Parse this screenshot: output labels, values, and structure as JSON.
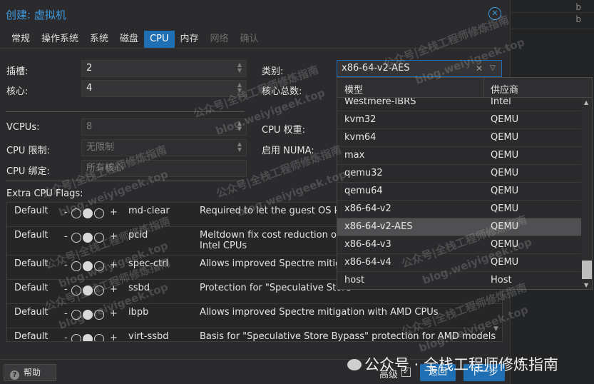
{
  "background": {
    "cells": [
      "b",
      "b"
    ]
  },
  "dialog": {
    "title": "创建: 虚拟机",
    "close_icon": "close-icon",
    "tabs": [
      {
        "label": "常规",
        "state": "normal"
      },
      {
        "label": "操作系统",
        "state": "normal"
      },
      {
        "label": "系统",
        "state": "normal"
      },
      {
        "label": "磁盘",
        "state": "normal"
      },
      {
        "label": "CPU",
        "state": "active"
      },
      {
        "label": "内存",
        "state": "normal"
      },
      {
        "label": "网络",
        "state": "disabled"
      },
      {
        "label": "确认",
        "state": "disabled"
      }
    ]
  },
  "form": {
    "sockets_label": "插槽:",
    "sockets_value": "2",
    "cores_label": "核心:",
    "cores_value": "4",
    "type_label": "类别:",
    "type_value": "x86-64-v2-AES",
    "total_cores_label": "核心总数:",
    "vcpus_label": "VCPUs:",
    "vcpus_value": "8",
    "cpu_weight_label": "CPU 权重:",
    "cpu_limit_label": "CPU 限制:",
    "cpu_limit_value": "无限制",
    "numa_label": "启用 NUMA:",
    "cpu_affinity_label": "CPU 绑定:",
    "cpu_affinity_value": "所有核心",
    "extra_flags_label": "Extra CPU Flags:"
  },
  "flags": [
    {
      "state": "Default",
      "minus": "-",
      "plus": "+",
      "name": "md-clear",
      "desc": "Required to let the guest OS kno"
    },
    {
      "state": "Default",
      "minus": "-",
      "plus": "+",
      "name": "pcid",
      "desc": "Meltdown fix cost reduction on W",
      "desc2": "Intel CPUs"
    },
    {
      "state": "Default",
      "minus": "-",
      "plus": "+",
      "name": "spec-ctrl",
      "desc": "Allows improved Spectre mitigatio"
    },
    {
      "state": "Default",
      "minus": "-",
      "plus": "+",
      "name": "ssbd",
      "desc": "Protection for \"Speculative Store"
    },
    {
      "state": "Default",
      "minus": "-",
      "plus": "+",
      "name": "ibpb",
      "desc": "Allows improved Spectre mitigation with AMD CPUs"
    },
    {
      "state": "Default",
      "minus": "-",
      "plus": "+",
      "name": "virt-ssbd",
      "desc": "Basis for \"Speculative Store Bypass\" protection for AMD models"
    }
  ],
  "dropdown": {
    "col_model": "模型",
    "col_vendor": "供应商",
    "rows": [
      {
        "model": "Westmere-IBRS",
        "vendor": "Intel"
      },
      {
        "model": "kvm32",
        "vendor": "QEMU"
      },
      {
        "model": "kvm64",
        "vendor": "QEMU"
      },
      {
        "model": "max",
        "vendor": "QEMU"
      },
      {
        "model": "qemu32",
        "vendor": "QEMU"
      },
      {
        "model": "qemu64",
        "vendor": "QEMU"
      },
      {
        "model": "x86-64-v2",
        "vendor": "QEMU"
      },
      {
        "model": "x86-64-v2-AES",
        "vendor": "QEMU",
        "selected": true
      },
      {
        "model": "x86-64-v3",
        "vendor": "QEMU"
      },
      {
        "model": "x86-64-v4",
        "vendor": "QEMU"
      },
      {
        "model": "host",
        "vendor": "Host"
      }
    ]
  },
  "footer": {
    "help_label": "帮助",
    "advanced_label": "高级",
    "advanced_checked": "✓",
    "back_label": "返回",
    "next_label": "下一步"
  },
  "watermark": {
    "lines": [
      "公众号|全栈工程师修炼指南",
      "blog.weiyigeek.top"
    ],
    "brand": "公众号 · 全栈工程师修炼指南"
  }
}
